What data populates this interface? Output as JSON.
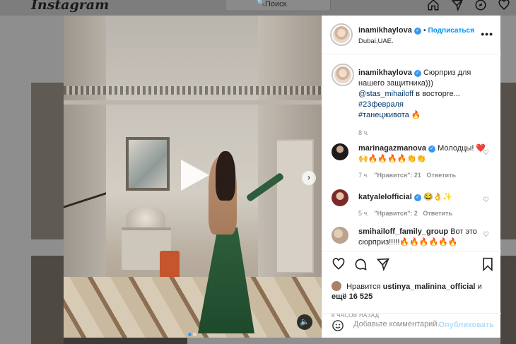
{
  "header": {
    "logo": "Instagram",
    "search_placeholder": "Поиск",
    "icons": [
      "home-icon",
      "direct-icon",
      "explore-icon",
      "activity-heart-icon"
    ]
  },
  "video": {
    "slide_count": 2,
    "active_slide": 1
  },
  "post": {
    "author": "inamikhaylova",
    "verified": true,
    "follow_label": "Подписаться",
    "separator": "•",
    "location": "Dubai,UAE.",
    "caption": {
      "text": "Сюрприз для нашего защитника)))",
      "mention": "@stas_mihailoff",
      "text2": "в восторге...",
      "tag1": "#23февраля",
      "tag2": "#танецживота",
      "emoji": "🔥",
      "time": "8 ч."
    }
  },
  "comments": [
    {
      "user": "marinagazmanova",
      "verified": true,
      "text": "Молодцы! ❤️🙌🔥🔥🔥🔥👏👏",
      "time": "7 ч.",
      "likes": "\"Нравится\": 21",
      "reply": "Ответить"
    },
    {
      "user": "katyalelofficial",
      "verified": true,
      "text": "😂👌✨",
      "time": "5 ч.",
      "likes": "\"Нравится\": 2",
      "reply": "Ответить"
    },
    {
      "user": "smihailoff_family_group",
      "verified": false,
      "text": "Вот это сюрприз!!!!!🔥🔥🔥🔥🔥🔥",
      "time": "",
      "likes": "",
      "reply": ""
    }
  ],
  "likes": {
    "prefix": "Нравится",
    "user": "ustinya_malinina_official",
    "and": "и",
    "others": "ещё 16 525"
  },
  "posted_ago": "8 ЧАСОВ НАЗАД",
  "add_comment": {
    "placeholder": "Добавьте комментарий...",
    "post_label": "Опубликовать"
  },
  "colors": {
    "accent": "#0095f6",
    "verified": "#3897f0",
    "overlay": "#8e8e8e"
  }
}
